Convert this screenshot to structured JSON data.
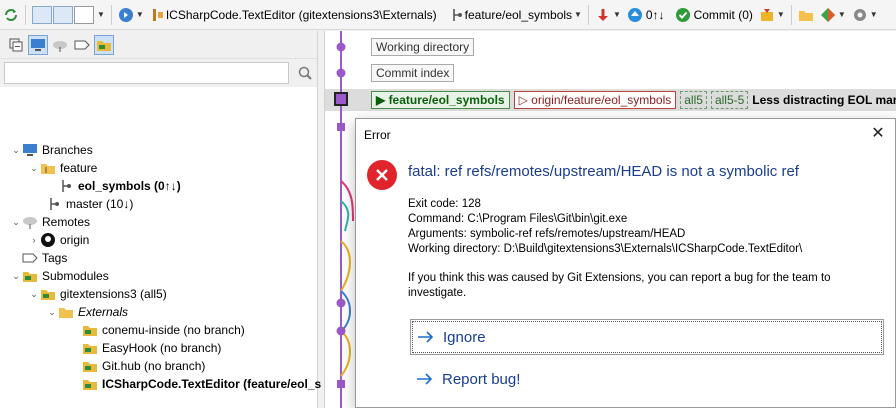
{
  "toolbar": {
    "repo_label": "ICSharpCode.TextEditor (gitextensions3\\Externals)",
    "branch_label": "feature/eol_symbols",
    "push_label": "0↑↓",
    "commit_label": "Commit (0)"
  },
  "sidebar": {
    "search_placeholder": "",
    "tree": [
      {
        "label": "Branches"
      },
      {
        "label": "feature"
      },
      {
        "label": "eol_symbols (0↑↓)"
      },
      {
        "label": "master (10↓)"
      },
      {
        "label": "Remotes"
      },
      {
        "label": "origin"
      },
      {
        "label": "Tags"
      },
      {
        "label": "Submodules"
      },
      {
        "label": "gitextensions3 (all5)"
      },
      {
        "label": "Externals"
      },
      {
        "label": "conemu-inside (no branch)"
      },
      {
        "label": "EasyHook (no branch)"
      },
      {
        "label": "Git.hub (no branch)"
      },
      {
        "label": "ICSharpCode.TextEditor (feature/eol_s"
      }
    ]
  },
  "revisions": {
    "working_directory": "Working directory",
    "commit_index": "Commit index",
    "local_branch": "feature/eol_symbols",
    "remote_branch": "origin/feature/eol_symbols",
    "tag1": "all5",
    "tag2": "all5-5",
    "message": "Less distracting EOL mark"
  },
  "dialog": {
    "title": "Error",
    "heading": "fatal: ref refs/remotes/upstream/HEAD is not a symbolic ref",
    "exit_code": "Exit code: 128",
    "command": "Command: C:\\Program Files\\Git\\bin\\git.exe",
    "arguments": "Arguments: symbolic-ref refs/remotes/upstream/HEAD",
    "working_directory": "Working directory: D:\\Build\\gitextensions3\\Externals\\ICSharpCode.TextEditor\\",
    "note": "If you think this was caused by Git Extensions, you can report a bug for the team to investigate.",
    "ignore_label": "Ignore",
    "report_label": "Report bug!"
  },
  "colors": {
    "graph_purple": "#9b59c9",
    "link_blue": "#1a3d8f",
    "error_red": "#e0242b"
  }
}
